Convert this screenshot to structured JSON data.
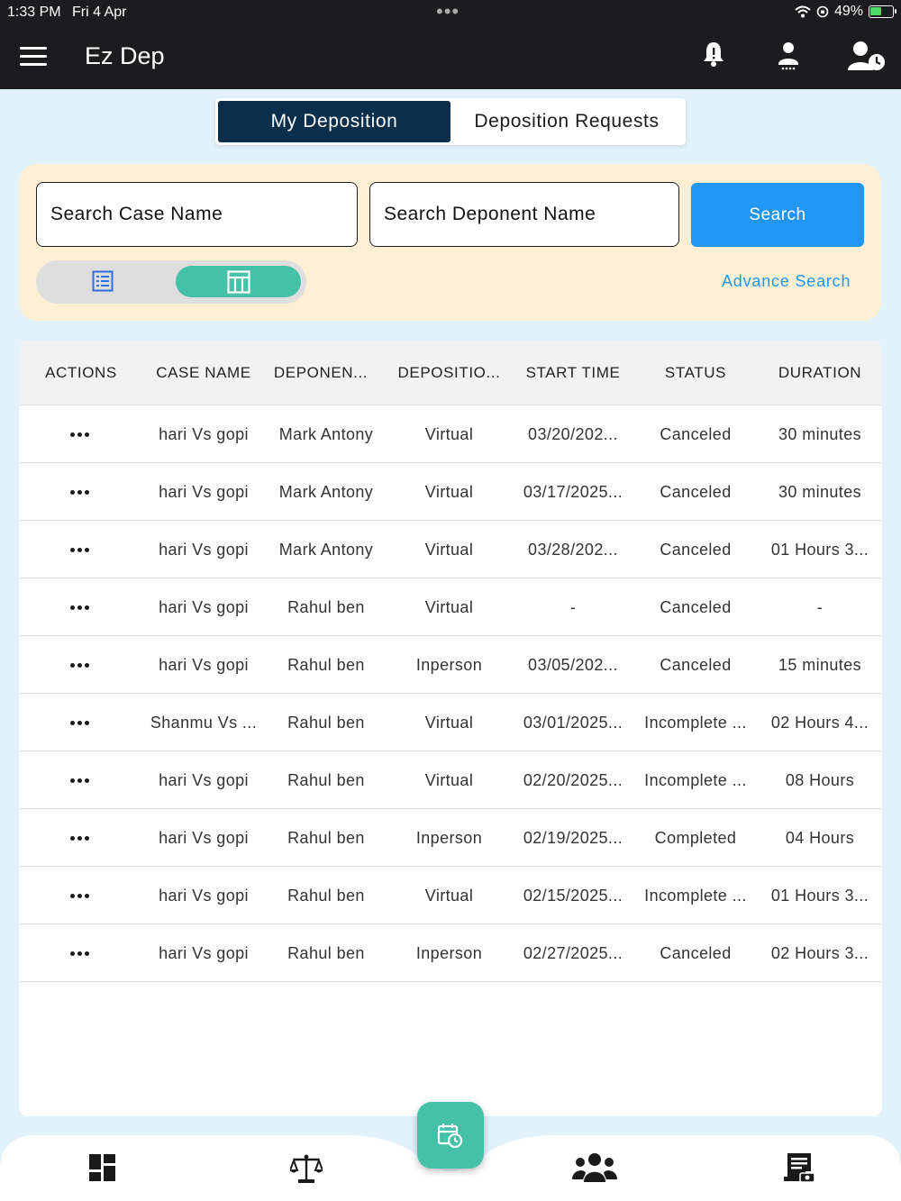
{
  "status_bar": {
    "time": "1:33 PM",
    "date": "Fri 4 Apr",
    "battery": "49%",
    "battery_level": 0.49
  },
  "header": {
    "title": "Ez Dep",
    "icons": [
      "menu-icon",
      "bell-icon",
      "user-icon",
      "user-clock-icon"
    ]
  },
  "tabs": [
    {
      "label": "My Deposition",
      "active": true
    },
    {
      "label": "Deposition Requests",
      "active": false
    }
  ],
  "search": {
    "case_placeholder": "Search Case Name",
    "deponent_placeholder": "Search Deponent Name",
    "button_label": "Search",
    "advance_label": "Advance Search",
    "view_mode": "table"
  },
  "table": {
    "headers": [
      "ACTIONS",
      "CASE NAME",
      "DEPONEN...",
      "DEPOSITIO...",
      "START TIME",
      "STATUS",
      "DURATION"
    ],
    "rows": [
      {
        "case": "hari Vs gopi",
        "deponent": "Mark Antony",
        "type": "Virtual",
        "start": "03/20/202...",
        "status": "Canceled",
        "duration": "30 minutes"
      },
      {
        "case": "hari Vs gopi",
        "deponent": "Mark Antony",
        "type": "Virtual",
        "start": "03/17/2025...",
        "status": "Canceled",
        "duration": "30 minutes"
      },
      {
        "case": "hari Vs gopi",
        "deponent": "Mark Antony",
        "type": "Virtual",
        "start": "03/28/202...",
        "status": "Canceled",
        "duration": "01 Hours 3..."
      },
      {
        "case": "hari Vs gopi",
        "deponent": "Rahul ben",
        "type": "Virtual",
        "start": "-",
        "status": "Canceled",
        "duration": "-"
      },
      {
        "case": "hari Vs gopi",
        "deponent": "Rahul ben",
        "type": "Inperson",
        "start": "03/05/202...",
        "status": "Canceled",
        "duration": "15 minutes"
      },
      {
        "case": "Shanmu Vs ...",
        "deponent": "Rahul ben",
        "type": "Virtual",
        "start": "03/01/2025...",
        "status": "Incomplete ...",
        "duration": "02 Hours 4..."
      },
      {
        "case": "hari Vs gopi",
        "deponent": "Rahul ben",
        "type": "Virtual",
        "start": "02/20/2025...",
        "status": "Incomplete ...",
        "duration": "08 Hours"
      },
      {
        "case": "hari Vs gopi",
        "deponent": "Rahul ben",
        "type": "Inperson",
        "start": "02/19/2025...",
        "status": "Completed",
        "duration": "04 Hours"
      },
      {
        "case": "hari Vs gopi",
        "deponent": "Rahul ben",
        "type": "Virtual",
        "start": "02/15/2025...",
        "status": "Incomplete ...",
        "duration": "01 Hours 3..."
      },
      {
        "case": "hari Vs gopi",
        "deponent": "Rahul ben",
        "type": "Inperson",
        "start": "02/27/2025...",
        "status": "Canceled",
        "duration": "02 Hours 3..."
      }
    ]
  },
  "bottom_nav": {
    "items": [
      "dashboard-icon",
      "scales-icon",
      "calendar-clock-icon",
      "group-icon",
      "invoice-icon"
    ],
    "active": "calendar-clock-icon"
  },
  "colors": {
    "header_bg": "#1c1c1e",
    "page_bg": "#e2f2fb",
    "active_tab": "#0b2f4b",
    "search_panel": "#fdefd4",
    "primary_blue": "#2196f3",
    "teal": "#45c1a7"
  }
}
